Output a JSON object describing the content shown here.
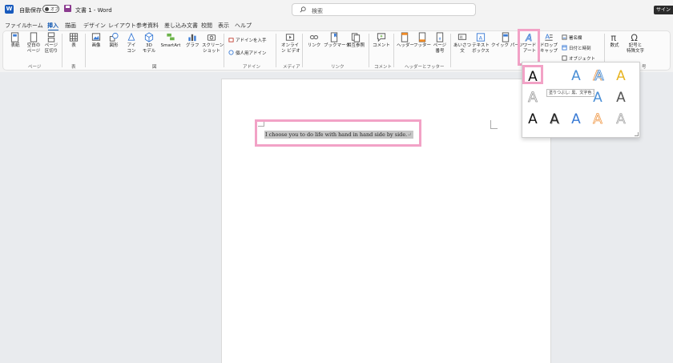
{
  "titlebar": {
    "app_icon_letter": "W",
    "autosave_label": "自動保存",
    "autosave_state": "オフ",
    "doc_title": "文書 1 - Word",
    "search_placeholder": "検索",
    "signin_label": "サイン"
  },
  "tabs": [
    "ファイル",
    "ホーム",
    "挿入",
    "描画",
    "デザイン",
    "レイアウト",
    "参考資料",
    "差し込み文書",
    "校閲",
    "表示",
    "ヘルプ"
  ],
  "active_tab_index": 2,
  "ribbon": {
    "buttons": {
      "cover": [
        "表紙"
      ],
      "blank": [
        "空白の",
        "ページ"
      ],
      "pagebreak": [
        "ページ",
        "区切り"
      ],
      "table": [
        "表"
      ],
      "picture": [
        "画像"
      ],
      "shape": [
        "図形"
      ],
      "icon": [
        "アイ",
        "コン"
      ],
      "model3d": [
        "3D",
        "モデル"
      ],
      "smartart": [
        "SmartArt"
      ],
      "graph": [
        "グラフ"
      ],
      "screenshot": [
        "スクリーン",
        "ショット"
      ],
      "online_video": [
        "オンライ",
        "ン ビデオ"
      ],
      "link": [
        "リンク"
      ],
      "bookmark": [
        "ブックマーク"
      ],
      "crossref": [
        "相互参照"
      ],
      "comment": [
        "コメント"
      ],
      "header": [
        "ヘッダー"
      ],
      "footer": [
        "フッター"
      ],
      "pagenum": [
        "ページ",
        "番号"
      ],
      "greeting": [
        "あいさつ",
        "文"
      ],
      "textbox": [
        "テキスト",
        "ボックス"
      ],
      "quickparts": [
        "クイック パーツ"
      ],
      "wordart": [
        "ワード",
        "アート"
      ],
      "dropcap": [
        "ドロップ",
        "キャップ"
      ],
      "equation": [
        "数式"
      ],
      "symbol": [
        "記号と",
        "特殊文字"
      ]
    },
    "small_items": {
      "get_addins": "アドインを入手",
      "my_addins": "個人用アドイン",
      "signature": "署名欄",
      "datetime": "日付と時刻",
      "object": "オブジェクト"
    },
    "groups": {
      "pages": "ページ",
      "tables": "表",
      "illustrations": "図",
      "addins": "アドイン",
      "media": "メディア",
      "links": "リンク",
      "comments": "コメント",
      "header_footer": "ヘッダーとフッター",
      "symbols_partial": "号"
    }
  },
  "document": {
    "text": "I choose you to do life with hand in hand side by side.",
    "paragraph_mark": "↵"
  },
  "wordart_gallery": {
    "letter": "A",
    "tooltip": "塗りつぶし: 黒、文字色 1; 影",
    "colors": {
      "selected_black": "#111111",
      "blue": "#4a8fd6",
      "orange": "#f09a4a",
      "gray": "#9a9a9a",
      "gold": "#e8b523"
    }
  }
}
